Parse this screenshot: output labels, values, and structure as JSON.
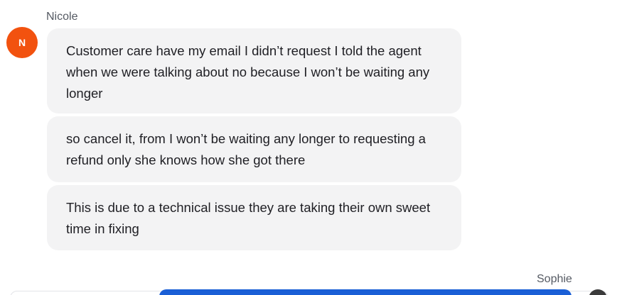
{
  "conversation": {
    "sender": {
      "name": "Nicole",
      "initial": "N",
      "avatar_color": "#f2520f"
    },
    "messages": [
      "Customer care have my email I didn’t request I told the agent when we were talking about no because I won’t be waiting any longer",
      "so cancel it, from I won’t be waiting any longer to requesting a refund only she knows how she got there",
      "This is due to a technical issue they are taking their own sweet time in fixing"
    ],
    "other_party": {
      "name": "Sophie"
    }
  },
  "colors": {
    "bubble_bg": "#f3f3f4",
    "accent": "#1a5fd6"
  }
}
